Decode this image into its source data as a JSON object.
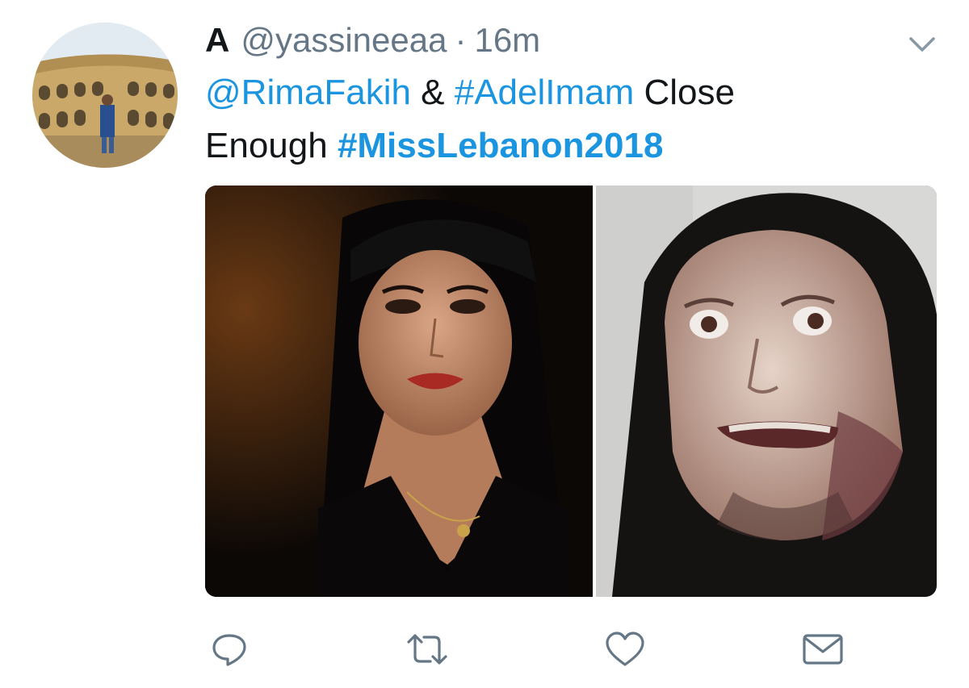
{
  "tweet": {
    "display_name": "A",
    "handle": "@yassineeaa",
    "separator": "·",
    "time": "16m",
    "text": {
      "mention": "@RimaFakih",
      "ampersand": " & ",
      "hashtag1": "#AdelImam",
      "word1": " Close",
      "word2": "Enough ",
      "hashtag2": "#MissLebanon2018"
    }
  },
  "icons": {
    "menu": "chevron-down-icon",
    "reply": "reply-icon",
    "retweet": "retweet-icon",
    "like": "heart-icon",
    "dm": "envelope-icon"
  },
  "colors": {
    "link": "#1b95e0",
    "text": "#14171a",
    "muted": "#657786"
  }
}
